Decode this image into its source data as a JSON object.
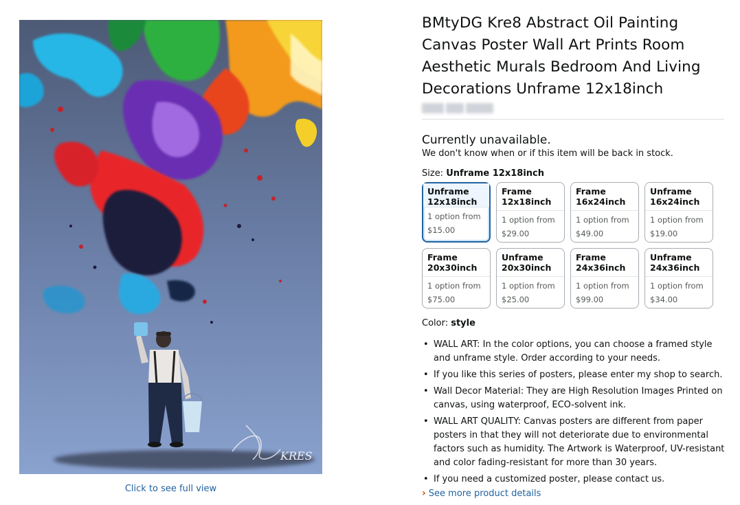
{
  "product": {
    "title": "BMtyDG Kre8 Abstract Oil Painting Canvas Poster Wall Art Prints Room Aesthetic Murals Bedroom And Living Decorations Unframe 12x18inch"
  },
  "image": {
    "full_view_link": "Click to see full view",
    "signature_text": "KRES"
  },
  "availability": {
    "title": "Currently unavailable.",
    "note": "We don't know when or if this item will be back in stock."
  },
  "size": {
    "label": "Size:",
    "selected": "Unframe 12x18inch",
    "options": [
      {
        "name_line1": "Unframe",
        "name_line2": "12x18inch",
        "option_text": "1 option from",
        "price": "$15.00",
        "selected": true
      },
      {
        "name_line1": "Frame",
        "name_line2": "12x18inch",
        "option_text": "1 option from",
        "price": "$29.00"
      },
      {
        "name_line1": "Frame",
        "name_line2": "16x24inch",
        "option_text": "1 option from",
        "price": "$49.00"
      },
      {
        "name_line1": "Unframe",
        "name_line2": "16x24inch",
        "option_text": "1 option from",
        "price": "$19.00"
      },
      {
        "name_line1": "Frame",
        "name_line2": "20x30inch",
        "option_text": "1 option from",
        "price": "$75.00"
      },
      {
        "name_line1": "Unframe",
        "name_line2": "20x30inch",
        "option_text": "1 option from",
        "price": "$25.00"
      },
      {
        "name_line1": "Frame",
        "name_line2": "24x36inch",
        "option_text": "1 option from",
        "price": "$99.00"
      },
      {
        "name_line1": "Unframe",
        "name_line2": "24x36inch",
        "option_text": "1 option from",
        "price": "$34.00"
      }
    ]
  },
  "color": {
    "label": "Color:",
    "value": "style"
  },
  "bullets": [
    "WALL ART: In the color options, you can choose a framed style and unframe style. Order according to your needs.",
    "If you like this series of posters, please enter my shop to search.",
    "Wall Decor Material: They are High Resolution Images Printed on canvas, using waterproof, ECO-solvent ink.",
    "WALL ART QUALITY: Canvas posters are different from paper posters in that they will not deteriorate due to environmental factors such as humidity. The Artwork is Waterproof, UV-resistant and color fading-resistant for more than 30 years.",
    "If you need a customized poster, please contact us."
  ],
  "more_details": {
    "label": "See more product details",
    "icon": "chevron-right-icon"
  },
  "colors": {
    "link": "#2162a1",
    "selected_border": "#2162a1",
    "chevron": "#c45500"
  }
}
